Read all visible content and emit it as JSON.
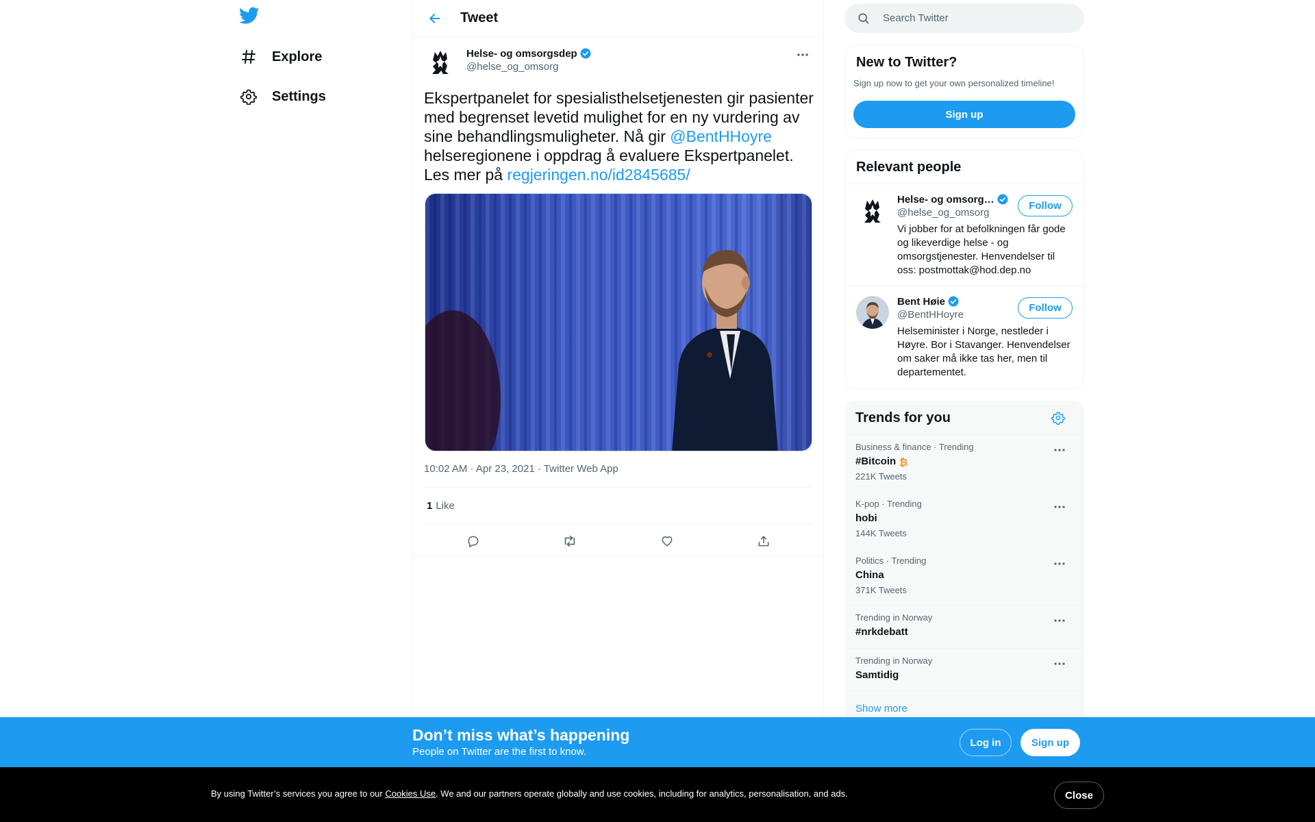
{
  "nav": {
    "logo_icon": "twitter-bird-icon",
    "items": [
      {
        "label": "Explore",
        "icon": "hashtag-icon"
      },
      {
        "label": "Settings",
        "icon": "gear-icon"
      }
    ]
  },
  "main": {
    "title": "Tweet",
    "back_icon": "arrow-left-icon"
  },
  "tweet": {
    "author_name": "Helse- og omsorgsdep",
    "author_handle": "@helse_og_omsorg",
    "text_part1": "Ekspertpanelet for spesialisthelsetjenesten gir pasienter med begrenset levetid mulighet for en ny vurdering av sine behandlingsmuligheter. Nå gir ",
    "mention": "@BentHHoyre",
    "text_part2": "  helseregionene i oppdrag å evaluere Ekspertpanelet. Les mer på ",
    "link": "regjeringen.no/id2845685/",
    "time": "10:02 AM",
    "date": "Apr 23, 2021",
    "source": "Twitter Web App",
    "like_count": "1",
    "like_label": "Like",
    "actions": [
      "reply-icon",
      "retweet-icon",
      "like-icon",
      "share-icon"
    ]
  },
  "search": {
    "placeholder": "Search Twitter"
  },
  "new_to_twitter": {
    "title": "New to Twitter?",
    "subtitle": "Sign up now to get your own personalized timeline!",
    "signup_label": "Sign up"
  },
  "relevant_people": {
    "title": "Relevant people",
    "people": [
      {
        "name": "Helse- og omsorg…",
        "handle": "@helse_og_omsorg",
        "bio": "Vi jobber for at befolkningen får gode og likeverdige helse - og omsorgstjenester. Henvendelser til oss: postmottak@hod.dep.no",
        "follow_label": "Follow"
      },
      {
        "name": "Bent Høie",
        "handle": "@BentHHoyre",
        "bio": "Helseminister i Norge, nestleder i Høyre. Bor i Stavanger. Henvendelser om saker må ikke tas her, men til departementet.",
        "follow_label": "Follow"
      }
    ]
  },
  "trends": {
    "title": "Trends for you",
    "items": [
      {
        "context": "Business & finance · Trending",
        "name": "#Bitcoin",
        "count": "221K Tweets"
      },
      {
        "context": "K-pop · Trending",
        "name": "hobi",
        "count": "144K Tweets"
      },
      {
        "context": "Politics · Trending",
        "name": "China",
        "count": "371K Tweets"
      },
      {
        "context": "Trending in Norway",
        "name": "#nrkdebatt",
        "count": ""
      },
      {
        "context": "Trending in Norway",
        "name": "Samtidig",
        "count": ""
      }
    ],
    "show_more": "Show more"
  },
  "bottom_bar": {
    "title": "Don’t miss what’s happening",
    "subtitle": "People on Twitter are the first to know.",
    "login_label": "Log in",
    "signup_label": "Sign up"
  },
  "cookie": {
    "text_before": "By using Twitter’s services you agree to our ",
    "link": "Cookies Use",
    "text_after": ". We and our partners operate globally and use cookies, including for analytics, personalisation, and ads.",
    "close_label": "Close"
  },
  "colors": {
    "brand": "#1d9bf0",
    "text": "#0f1419",
    "secondary": "#536471",
    "border": "#eff3f4",
    "cookie_bg": "#000000",
    "bitcoin": "#f7931a"
  }
}
